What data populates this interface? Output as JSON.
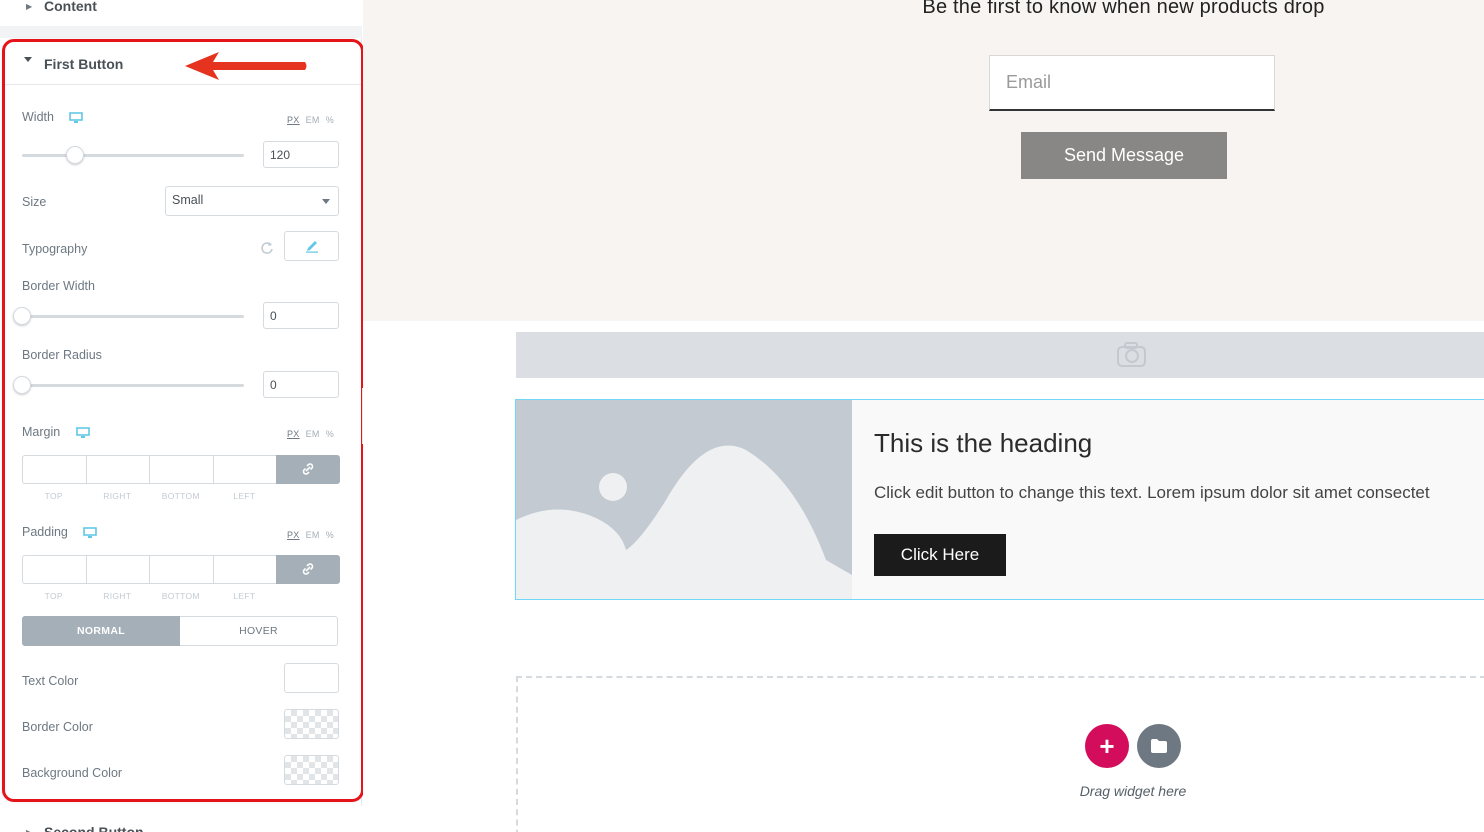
{
  "panel": {
    "content_section_label": "Content",
    "first_button": {
      "title": "First Button",
      "width": {
        "label": "Width",
        "units": [
          "PX",
          "EM",
          "%"
        ],
        "value": "120",
        "slider_fraction": 0.24
      },
      "size": {
        "label": "Size",
        "value": "Small"
      },
      "typography": {
        "label": "Typography"
      },
      "border_width": {
        "label": "Border Width",
        "value": "0"
      },
      "border_radius": {
        "label": "Border Radius",
        "value": "0"
      },
      "margin": {
        "label": "Margin",
        "units": [
          "PX",
          "EM",
          "%"
        ],
        "sides": [
          "TOP",
          "RIGHT",
          "BOTTOM",
          "LEFT"
        ]
      },
      "padding": {
        "label": "Padding",
        "units": [
          "PX",
          "EM",
          "%"
        ],
        "sides": [
          "TOP",
          "RIGHT",
          "BOTTOM",
          "LEFT"
        ]
      },
      "tabs": {
        "normal": "NORMAL",
        "hover": "HOVER"
      },
      "text_color": {
        "label": "Text Color"
      },
      "border_color": {
        "label": "Border Color"
      },
      "background_color": {
        "label": "Background Color"
      }
    },
    "second_section_label": "Second Button"
  },
  "canvas": {
    "subscribe": {
      "title": "Be the first to know when new products drop",
      "email_placeholder": "Email",
      "send_label": "Send Message"
    },
    "card": {
      "heading": "This is the heading",
      "text": "Click edit button to change this text. Lorem ipsum dolor sit amet consectet",
      "button_label": "Click Here"
    },
    "drop_zone": {
      "text": "Drag widget here"
    }
  },
  "colors": {
    "highlight_red": "#e5141b",
    "add_button": "#d30c5c",
    "send_button": "#898786",
    "card_border": "#71d7f7"
  }
}
